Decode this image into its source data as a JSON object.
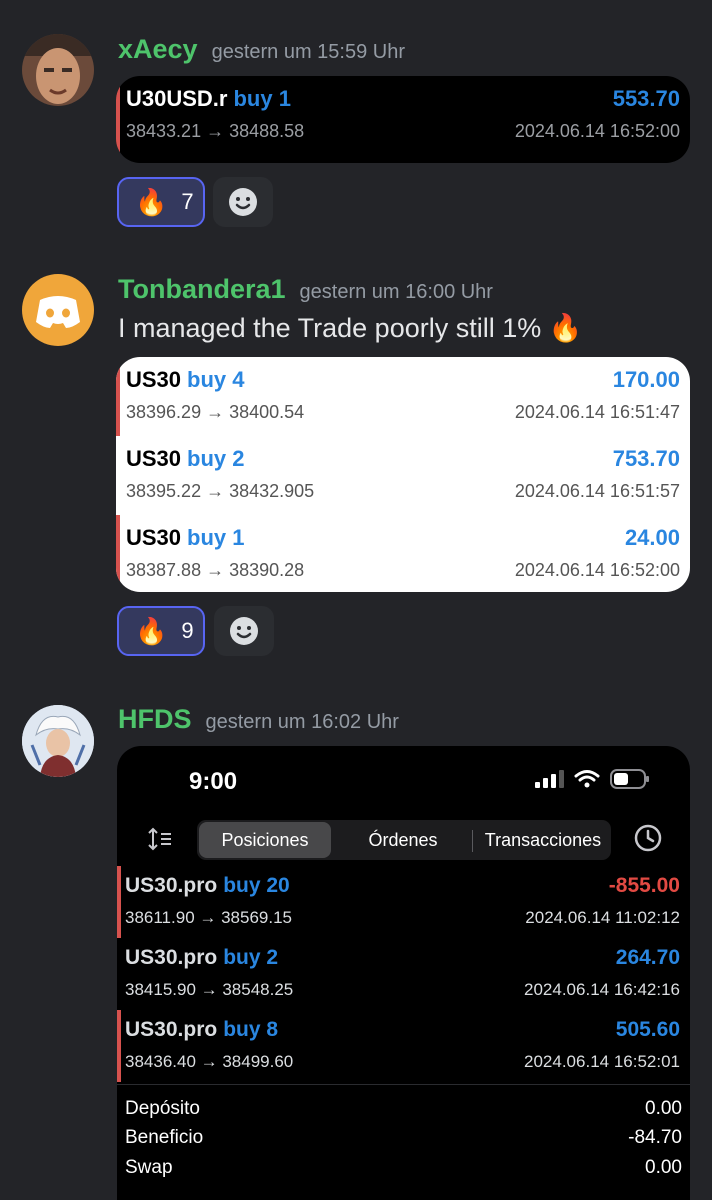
{
  "messages": [
    {
      "username": "xAecy",
      "timestamp": "gestern um 15:59 Uhr",
      "trades": [
        {
          "symbol": "U30USD.r",
          "direction": "buy 1",
          "profit": "553.70",
          "prices": "38433.21 → 38488.58",
          "time": "2024.06.14 16:52:00"
        }
      ],
      "reaction": {
        "emoji": "🔥",
        "count": "7"
      }
    },
    {
      "username": "Tonbandera1",
      "timestamp": "gestern um 16:00 Uhr",
      "text": "I managed the Trade poorly still 1% 🔥",
      "trades": [
        {
          "symbol": "US30",
          "direction": "buy 4",
          "profit": "170.00",
          "prices": "38396.29 → 38400.54",
          "time": "2024.06.14 16:51:47"
        },
        {
          "symbol": "US30",
          "direction": "buy 2",
          "profit": "753.70",
          "prices": "38395.22 → 38432.905",
          "time": "2024.06.14 16:51:57"
        },
        {
          "symbol": "US30",
          "direction": "buy 1",
          "profit": "24.00",
          "prices": "38387.88 → 38390.28",
          "time": "2024.06.14 16:52:00"
        }
      ],
      "reaction": {
        "emoji": "🔥",
        "count": "9"
      }
    },
    {
      "username": "HFDS",
      "timestamp": "gestern um 16:02 Uhr"
    }
  ],
  "phone": {
    "clock": "9:00",
    "tabs": [
      "Posiciones",
      "Órdenes",
      "Transacciones"
    ],
    "trades": [
      {
        "symbol": "US30.pro",
        "direction": "buy 20",
        "profit": "-855.00",
        "prices": "38611.90 → 38569.15",
        "time": "2024.06.14 11:02:12"
      },
      {
        "symbol": "US30.pro",
        "direction": "buy 2",
        "profit": "264.70",
        "prices": "38415.90 → 38548.25",
        "time": "2024.06.14 16:42:16"
      },
      {
        "symbol": "US30.pro",
        "direction": "buy 8",
        "profit": "505.60",
        "prices": "38436.40 → 38499.60",
        "time": "2024.06.14 16:52:01"
      }
    ],
    "summary": [
      {
        "label": "Depósito",
        "value": "0.00"
      },
      {
        "label": "Beneficio",
        "value": "-84.70"
      },
      {
        "label": "Swap",
        "value": "0.00"
      }
    ]
  },
  "colors": {
    "username": "#4ec46b",
    "buy": "#2a86e0",
    "loss": "#e24a43",
    "bar": "#d6524e",
    "blurple": "#5865f2"
  }
}
